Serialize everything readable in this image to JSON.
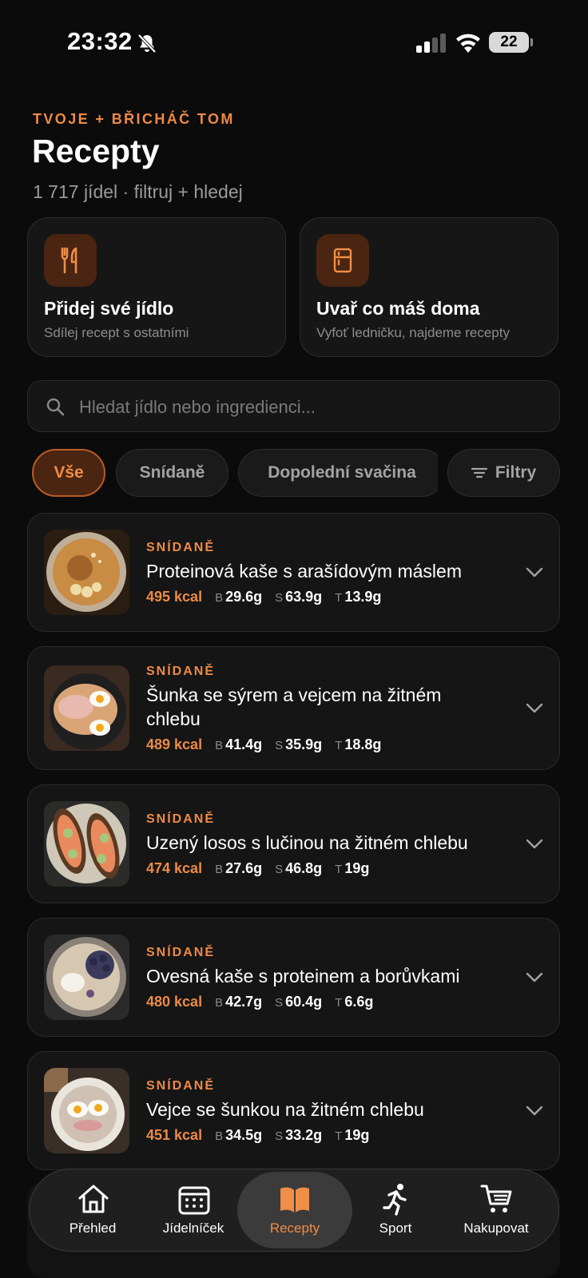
{
  "status_bar": {
    "time": "23:32",
    "battery": "22"
  },
  "header": {
    "kicker": "TVOJE + BŘICHÁČ TOM",
    "title": "Recepty",
    "subtitle": "1 717 jídel · filtruj + hledej"
  },
  "actions": [
    {
      "title": "Přidej své jídlo",
      "subtitle": "Sdílej recept s ostatními",
      "icon": "fork-knife-icon"
    },
    {
      "title": "Uvař co máš doma",
      "subtitle": "Vyfoť ledničku, najdeme recepty",
      "icon": "fridge-icon"
    }
  ],
  "search": {
    "placeholder": "Hledat jídlo nebo ingredienci..."
  },
  "filters": {
    "chips": [
      "Vše",
      "Snídaně",
      "Dopolední svačina"
    ],
    "active_chip": "Vše",
    "filter_button": "Filtry"
  },
  "macro_labels": {
    "protein": "B",
    "carbs": "S",
    "fat": "T"
  },
  "recipes": [
    {
      "category": "SNÍDANĚ",
      "name": "Proteinová kaše s arašídovým máslem",
      "kcal": "495 kcal",
      "protein": "29.6g",
      "carbs": "63.9g",
      "fat": "13.9g"
    },
    {
      "category": "SNÍDANĚ",
      "name": "Šunka se sýrem a vejcem na žitném chlebu",
      "kcal": "489 kcal",
      "protein": "41.4g",
      "carbs": "35.9g",
      "fat": "18.8g"
    },
    {
      "category": "SNÍDANĚ",
      "name": "Uzený losos s lučinou na žitném chlebu",
      "kcal": "474 kcal",
      "protein": "27.6g",
      "carbs": "46.8g",
      "fat": "19g"
    },
    {
      "category": "SNÍDANĚ",
      "name": "Ovesná kaše s proteinem a borůvkami",
      "kcal": "480 kcal",
      "protein": "42.7g",
      "carbs": "60.4g",
      "fat": "6.6g"
    },
    {
      "category": "SNÍDANĚ",
      "name": "Vejce se šunkou na žitném chlebu",
      "kcal": "451 kcal",
      "protein": "34.5g",
      "carbs": "33.2g",
      "fat": "19g"
    }
  ],
  "nav": {
    "items": [
      {
        "label": "Přehled",
        "icon": "home-icon"
      },
      {
        "label": "Jídelníček",
        "icon": "calendar-icon"
      },
      {
        "label": "Recepty",
        "icon": "book-icon"
      },
      {
        "label": "Sport",
        "icon": "runner-icon"
      },
      {
        "label": "Nakupovat",
        "icon": "cart-icon"
      }
    ],
    "active": "Recepty"
  },
  "colors": {
    "accent": "#ee8a45",
    "background": "#0b0b0b",
    "card": "#151515"
  }
}
